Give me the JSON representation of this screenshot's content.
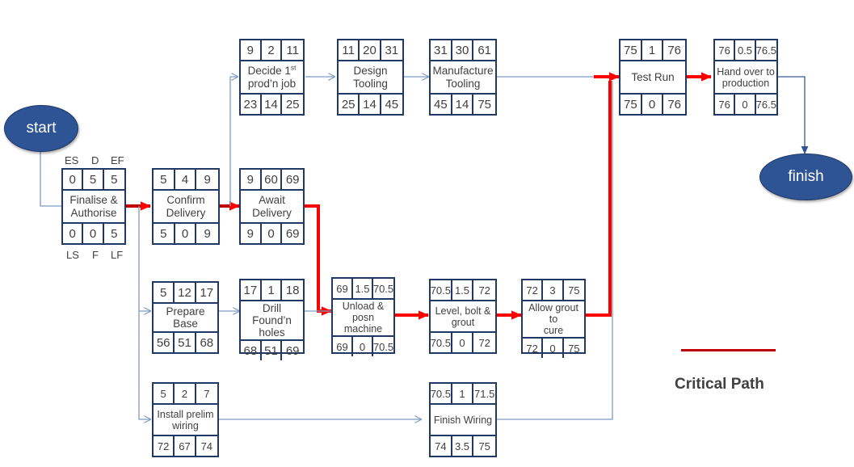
{
  "diagram": {
    "title": "Project Network Diagram (Critical Path Method)",
    "colors": {
      "node_border": "#1F3864",
      "terminal_fill": "#2E5496",
      "critical_path": "#FF0000",
      "normal_link": "#7E9BC4",
      "legend_line": "#C00000",
      "text": "#404040"
    }
  },
  "terminals": {
    "start": "start",
    "finish": "finish"
  },
  "legend": {
    "top": {
      "es": "ES",
      "d": "D",
      "ef": "EF"
    },
    "bottom": {
      "ls": "LS",
      "f": "F",
      "lf": "LF"
    },
    "key_text": "Critical Path"
  },
  "nodes": [
    {
      "id": "finalise-authorise",
      "name": "Finalise &\nAuthorise",
      "name_line1": "Finalise &",
      "name_line2": "Authorise",
      "es": "0",
      "d": "5",
      "ef": "5",
      "ls": "0",
      "f": "0",
      "lf": "5",
      "critical": true
    },
    {
      "id": "confirm-delivery",
      "name": "Confirm Delivery",
      "name_line1": "Confirm",
      "name_line2": "Delivery",
      "es": "5",
      "d": "4",
      "ef": "9",
      "ls": "5",
      "f": "0",
      "lf": "9",
      "critical": true
    },
    {
      "id": "await-delivery",
      "name": "Await Delivery",
      "name_line1": "Await",
      "name_line2": "Delivery",
      "es": "9",
      "d": "60",
      "ef": "69",
      "ls": "9",
      "f": "0",
      "lf": "69",
      "critical": true
    },
    {
      "id": "decide-first-prodn-job",
      "name": "Decide 1st prod'n job",
      "name_line1": "Decide 1",
      "name_sup": "st",
      "name_line2": "prod’n job",
      "es": "9",
      "d": "2",
      "ef": "11",
      "ls": "23",
      "f": "14",
      "lf": "25",
      "critical": false
    },
    {
      "id": "design-tooling",
      "name": "Design Tooling",
      "name_line1": "Design",
      "name_line2": "Tooling",
      "es": "11",
      "d": "20",
      "ef": "31",
      "ls": "25",
      "f": "14",
      "lf": "45",
      "critical": false
    },
    {
      "id": "manufacture-tooling",
      "name": "Manufacture Tooling",
      "name_line1": "Manufacture",
      "name_line2": "Tooling",
      "es": "31",
      "d": "30",
      "ef": "61",
      "ls": "45",
      "f": "14",
      "lf": "75",
      "critical": false
    },
    {
      "id": "prepare-base",
      "name": "Prepare Base",
      "name_line1": "Prepare Base",
      "name_line2": "",
      "es": "5",
      "d": "12",
      "ef": "17",
      "ls": "56",
      "f": "51",
      "lf": "68",
      "critical": false
    },
    {
      "id": "drill-foundn-holes",
      "name": "Drill Found'n holes",
      "name_line1": "Drill Found’n",
      "name_line2": "holes",
      "es": "17",
      "d": "1",
      "ef": "18",
      "ls": "68",
      "f": "51",
      "lf": "69",
      "critical": false
    },
    {
      "id": "unload-posn-machine",
      "name": "Unload & posn machine",
      "name_line1": "Unload & posn",
      "name_line2": "machine",
      "es": "69",
      "d": "1.5",
      "ef": "70.5",
      "ls": "69",
      "f": "0",
      "lf": "70.5",
      "critical": true
    },
    {
      "id": "level-bolt-grout",
      "name": "Level, bolt & grout",
      "name_line1": "Level, bolt &",
      "name_line2": "grout",
      "es": "70.5",
      "d": "1.5",
      "ef": "72",
      "ls": "70.5",
      "f": "0",
      "lf": "72",
      "critical": true
    },
    {
      "id": "allow-grout-to-cure",
      "name": "Allow grout to cure",
      "name_line1": "Allow grout to",
      "name_line2": "cure",
      "es": "72",
      "d": "3",
      "ef": "75",
      "ls": "72",
      "f": "0",
      "lf": "75",
      "critical": true
    },
    {
      "id": "install-prelim-wiring",
      "name": "Install prelim wiring",
      "name_line1": "Install prelim",
      "name_line2": "wiring",
      "es": "5",
      "d": "2",
      "ef": "7",
      "ls": "72",
      "f": "67",
      "lf": "74",
      "critical": false
    },
    {
      "id": "finish-wiring",
      "name": "Finish Wiring",
      "name_line1": "Finish Wiring",
      "name_line2": "",
      "es": "70.5",
      "d": "1",
      "ef": "71.5",
      "ls": "74",
      "f": "3.5",
      "lf": "75",
      "critical": false
    },
    {
      "id": "test-run",
      "name": "Test Run",
      "name_line1": "Test Run",
      "name_line2": "",
      "es": "75",
      "d": "1",
      "ef": "76",
      "ls": "75",
      "f": "0",
      "lf": "76",
      "critical": true
    },
    {
      "id": "hand-over-to-production",
      "name": "Hand over to production",
      "name_line1": "Hand over to",
      "name_line2": "production",
      "es": "76",
      "d": "0.5",
      "ef": "76.5",
      "ls": "76",
      "f": "0",
      "lf": "76.5",
      "critical": true
    }
  ]
}
